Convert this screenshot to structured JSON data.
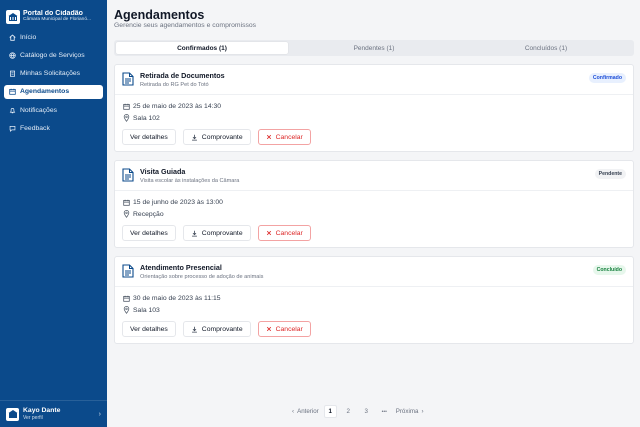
{
  "app": {
    "title": "Portal do Cidadão",
    "subtitle": "Câmara Municipal de Florianó..."
  },
  "sidebar": {
    "items": [
      {
        "label": "Início",
        "icon": "home-icon"
      },
      {
        "label": "Catálogo de Serviços",
        "icon": "globe-icon"
      },
      {
        "label": "Minhas Solicitações",
        "icon": "clipboard-icon"
      },
      {
        "label": "Agendamentos",
        "icon": "calendar-icon",
        "active": true
      },
      {
        "label": "Notificações",
        "icon": "bell-icon"
      },
      {
        "label": "Feedback",
        "icon": "message-icon"
      }
    ]
  },
  "user": {
    "name": "Kayo Dante",
    "link": "Ver perfil"
  },
  "page": {
    "title": "Agendamentos",
    "subtitle": "Gerencie seus agendamentos e compromissos"
  },
  "tabs": [
    {
      "label": "Confirmados (1)",
      "active": true
    },
    {
      "label": "Pendentes (1)",
      "active": false
    },
    {
      "label": "Concluídos (1)",
      "active": false
    }
  ],
  "appointments": [
    {
      "title": "Retirada de Documentos",
      "description": "Retirada do RG Pet do Totó",
      "status": "Confirmado",
      "datetime": "25 de maio de 2023 às 14:30",
      "location": "Sala 102"
    },
    {
      "title": "Visita Guiada",
      "description": "Visita escolar às instalações da Câmara",
      "status": "Pendente",
      "datetime": "15 de junho de 2023 às 13:00",
      "location": "Recepção"
    },
    {
      "title": "Atendimento Presencial",
      "description": "Orientação sobre processo de adoção de animais",
      "status": "Concluído",
      "datetime": "30 de maio de 2023 às 11:15",
      "location": "Sala 103"
    }
  ],
  "actions": {
    "details": "Ver detalhes",
    "receipt": "Comprovante",
    "cancel": "Cancelar"
  },
  "pagination": {
    "previous": "Anterior",
    "pages": [
      "1",
      "2",
      "3"
    ],
    "ellipsis": "•••",
    "next": "Próxima",
    "current": "1"
  },
  "colors": {
    "sidebar": "#0b4a8b",
    "confirmed": "#1d4ed8",
    "completed": "#15803d",
    "danger": "#dc2626"
  }
}
